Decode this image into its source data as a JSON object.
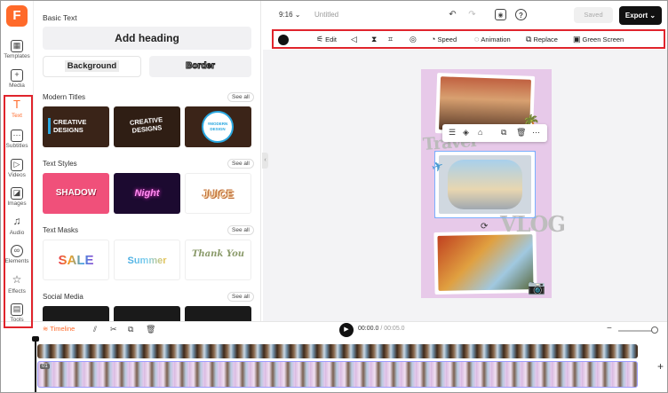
{
  "nav": {
    "items": [
      {
        "label": "Templates",
        "icon": "templates-icon"
      },
      {
        "label": "Media",
        "icon": "media-icon"
      },
      {
        "label": "Text",
        "icon": "text-icon",
        "active": true
      },
      {
        "label": "Subtitles",
        "icon": "subtitles-icon"
      },
      {
        "label": "Videos",
        "icon": "videos-icon"
      },
      {
        "label": "Images",
        "icon": "images-icon"
      },
      {
        "label": "Audio",
        "icon": "audio-icon"
      },
      {
        "label": "Elements",
        "icon": "elements-icon"
      },
      {
        "label": "Effects",
        "icon": "effects-icon"
      },
      {
        "label": "Tools",
        "icon": "tools-icon"
      }
    ],
    "logo": "F"
  },
  "panel": {
    "title": "Basic Text",
    "add_heading": "Add heading",
    "background_btn": "Background",
    "border_btn": "Border",
    "see_all": "See all",
    "sections": [
      {
        "title": "Modern Titles",
        "thumbs": [
          "CREATIVE DESIGNS",
          "CREATIVE DESIGNS",
          "#MODERN DESIGN"
        ]
      },
      {
        "title": "Text Styles",
        "thumbs": [
          "SHADOW",
          "Night",
          "JUICE"
        ]
      },
      {
        "title": "Text Masks",
        "thumbs": [
          "SALE",
          "Summer",
          "Thank You"
        ]
      },
      {
        "title": "Social Media",
        "thumbs": []
      }
    ]
  },
  "topbar": {
    "ratio": "9:16 ⌄",
    "project_name": "Untitled",
    "saved": "Saved",
    "export": "Export ⌄"
  },
  "toolbar": {
    "items": [
      "Edit",
      "Speed",
      "Animation",
      "Replace",
      "Green Screen"
    ]
  },
  "canvas": {
    "travel_text": "Travel",
    "vlog_text": "VLOG"
  },
  "timeline": {
    "label": "Timeline",
    "current_time": "00:00.0",
    "duration": "/ 00:05.0",
    "clip_tag": "01"
  },
  "colors": {
    "accent": "#ff6a2a",
    "highlight": "#e0242c",
    "poster_bg": "#e7c9e9"
  }
}
